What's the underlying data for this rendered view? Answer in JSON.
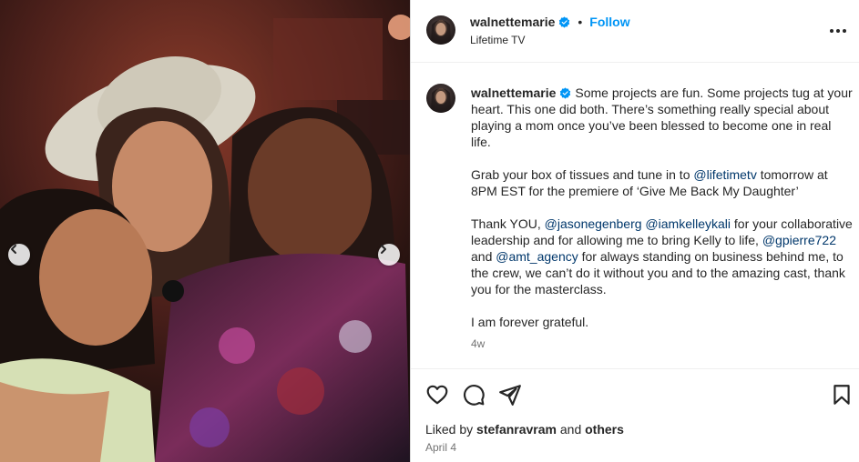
{
  "header": {
    "username": "walnettemarie",
    "follow_label": "Follow",
    "dot": "•",
    "subtitle": "Lifetime TV"
  },
  "caption": {
    "username": "walnettemarie",
    "paragraph1": "Some projects are fun. Some projects tug at your heart. This one did both. There’s something really special about playing a mom once you’ve been blessed to become one in real life.",
    "p2_before": "Grab your box of tissues and tune in to ",
    "p2_mention": "@lifetimetv",
    "p2_after": " tomorrow at 8PM EST for the premiere of ‘Give Me Back My Daughter’",
    "p3_a": "Thank YOU, ",
    "p3_mention1": "@jasonegenberg",
    "p3_b": " ",
    "p3_mention2": "@iamkelleykali",
    "p3_c": " for your collaborative leadership and for allowing me to bring Kelly to life, ",
    "p3_mention3": "@gpierre722",
    "p3_d": " and ",
    "p3_mention4": "@amt_agency",
    "p3_e": " for always standing on business behind me, to the crew, we can’t do it without you and to the amazing cast, thank you for the masterclass.",
    "paragraph4": "I am forever grateful.",
    "timestamp": "4w"
  },
  "footer": {
    "liked_by_prefix": "Liked by ",
    "liked_by_user": "stefanravram",
    "liked_by_and": " and ",
    "liked_by_others": "others",
    "date": "April 4"
  },
  "icons": {
    "verified": "verified-badge-icon",
    "more": "more-options-icon",
    "like": "heart-icon",
    "comment": "comment-icon",
    "share": "share-icon",
    "save": "bookmark-icon",
    "carousel_prev": "chevron-left-icon",
    "carousel_next": "chevron-right-icon"
  },
  "colors": {
    "follow": "#0095f6",
    "mention": "#00376b",
    "verified": "#0095f6",
    "muted": "#737373"
  }
}
